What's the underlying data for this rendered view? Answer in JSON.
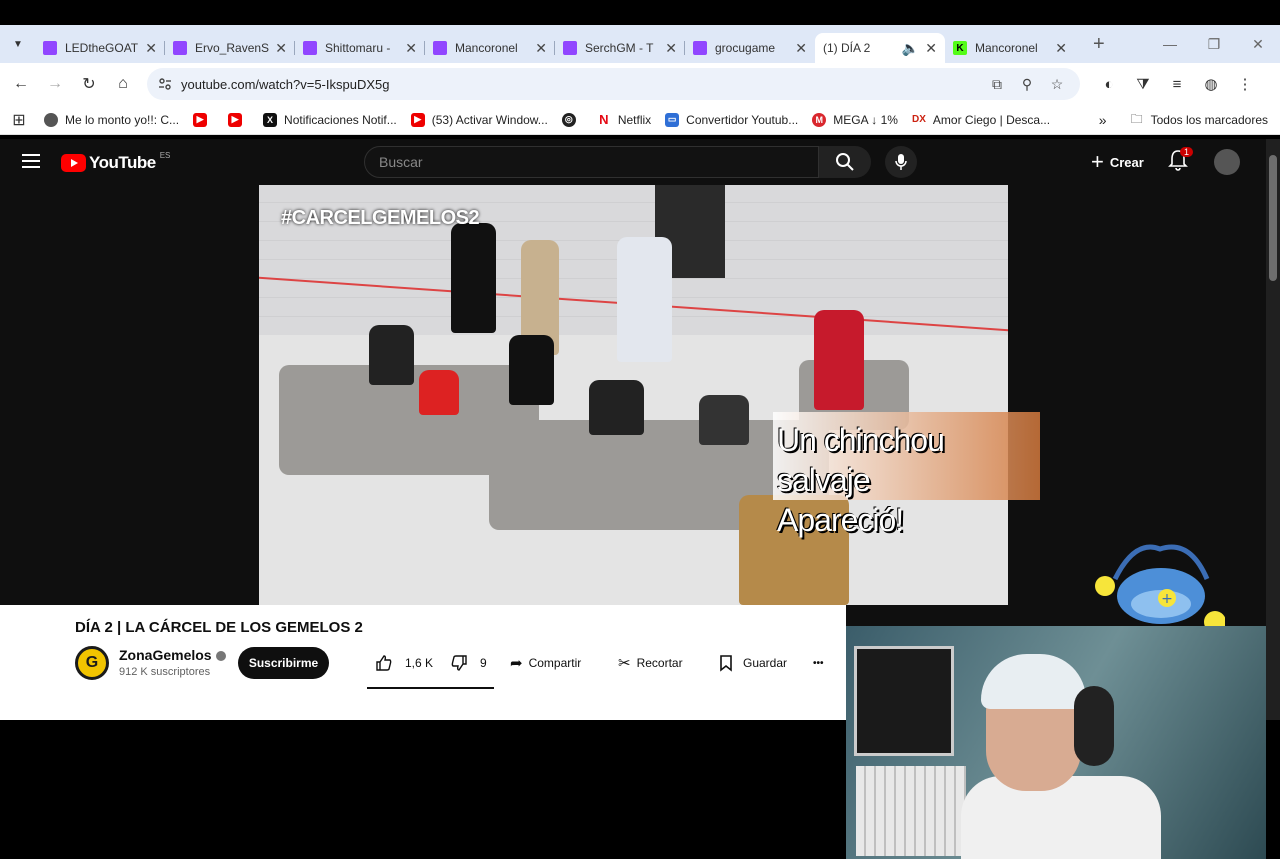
{
  "browser": {
    "tabs": [
      {
        "title": "LEDtheGOAT",
        "type": "twitch"
      },
      {
        "title": "Ervo_RavenS",
        "type": "twitch"
      },
      {
        "title": "Shittomaru -",
        "type": "twitch"
      },
      {
        "title": "Mancoronel",
        "type": "twitch"
      },
      {
        "title": "SerchGM - T",
        "type": "twitch"
      },
      {
        "title": "grocugame",
        "type": "twitch"
      },
      {
        "title": "(1) DÍA 2",
        "type": "youtube",
        "active": true
      },
      {
        "title": "Mancoronel",
        "type": "kick"
      }
    ],
    "url": "youtube.com/watch?v=5-IkspuDX5g",
    "bookmarks": [
      {
        "label": "Me lo monto yo!!: C...",
        "icon": "avatar-icon"
      },
      {
        "label": "",
        "icon": "youtube-icon"
      },
      {
        "label": "",
        "icon": "youtube-icon"
      },
      {
        "label": "Notificaciones Notif...",
        "icon": "x-icon"
      },
      {
        "label": "(53) Activar Window...",
        "icon": "youtube-icon"
      },
      {
        "label": "",
        "icon": "globe-icon"
      },
      {
        "label": "Netflix",
        "icon": "netflix-icon"
      },
      {
        "label": "Convertidor Youtub...",
        "icon": "converter-icon"
      },
      {
        "label": "MEGA ↓ 1%",
        "icon": "mega-icon"
      },
      {
        "label": "Amor Ciego | Desca...",
        "icon": "dx-icon"
      }
    ],
    "bookmarks_more": "»",
    "all_bookmarks": "Todos los marcadores"
  },
  "youtube": {
    "logo_text": "YouTube",
    "country": "ES",
    "search_placeholder": "Buscar",
    "create_label": "Crear",
    "notifications_count": "1",
    "video": {
      "hashtag": "#CARCELGEMELOS2",
      "overlay_line1": "Un chinchou salvaje",
      "overlay_line2": "Apareció!",
      "title": "DÍA 2 | LA CÁRCEL DE LOS GEMELOS 2"
    },
    "channel": {
      "name": "ZonaGemelos",
      "avatar_letter": "G",
      "subscribers": "912 K suscriptores",
      "subscribe_label": "Suscribirme"
    },
    "actions": {
      "likes": "1,6 K",
      "dislikes": "9",
      "share": "Compartir",
      "clip": "Recortar",
      "save": "Guardar",
      "more": "•••"
    }
  },
  "colors": {
    "tabstrip": "#dfe8f7",
    "youtube_bg": "#0f0f0f",
    "brand_red": "#ff0000",
    "twitch": "#9146ff",
    "kick": "#53fc18"
  }
}
